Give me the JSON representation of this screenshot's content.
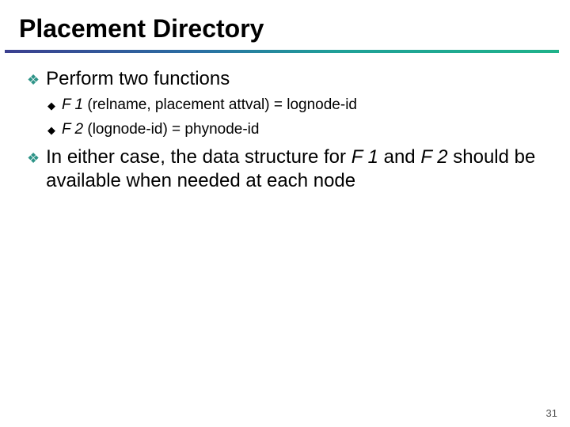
{
  "title": "Placement Directory",
  "bullets": {
    "b1": {
      "text": "Perform two functions",
      "sub": {
        "s1_pre": "F 1",
        "s1_post": " (relname, placement attval) = lognode-id",
        "s2_pre": "F 2",
        "s2_post": " (lognode-id) = phynode-id"
      }
    },
    "b2": {
      "pre": "In either case, the data structure for ",
      "f1": "F 1",
      "mid": " and ",
      "f2": "F 2",
      "post": " should be available when needed at each node"
    }
  },
  "page_number": "31"
}
